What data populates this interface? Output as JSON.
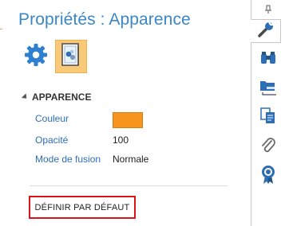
{
  "panel": {
    "title": "Propriétés : Apparence",
    "modes": [
      {
        "icon": "gear-icon",
        "selected": false
      },
      {
        "icon": "properties-icon",
        "selected": true
      }
    ]
  },
  "section": {
    "title": "APPARENCE",
    "properties": [
      {
        "label": "Couleur",
        "value": "",
        "color": "#f7941d"
      },
      {
        "label": "Opacité",
        "value": "100"
      },
      {
        "label": "Mode de fusion",
        "value": "Normale"
      }
    ]
  },
  "actions": {
    "reset_label": "DÉFINIR PAR DÉFAUT"
  },
  "tabs": [
    {
      "icon": "wrench-icon",
      "active": true
    },
    {
      "icon": "binoculars-icon",
      "active": false
    },
    {
      "icon": "folder-tree-icon",
      "active": false
    },
    {
      "icon": "copy-pages-icon",
      "active": false
    },
    {
      "icon": "paperclip-icon",
      "active": false
    },
    {
      "icon": "award-ribbon-icon",
      "active": false
    }
  ],
  "colors": {
    "title": "#3a87c8",
    "label": "#2e6eb4",
    "accent": "#f7941d",
    "highlight_border": "#d9141b",
    "selected_mode_bg": "#f9c97a"
  }
}
